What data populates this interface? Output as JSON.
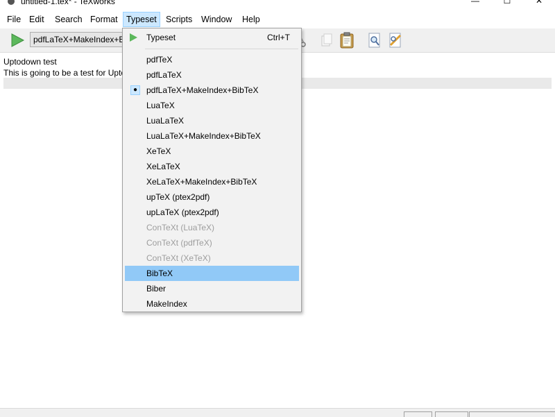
{
  "window": {
    "title": "untitled-1.tex* - TeXworks",
    "minimize_glyph": "—",
    "maximize_glyph": "☐",
    "close_glyph": "✕"
  },
  "menubar": {
    "file": "File",
    "edit": "Edit",
    "search": "Search",
    "format": "Format",
    "typeset": "Typeset",
    "scripts": "Scripts",
    "window": "Window",
    "help": "Help"
  },
  "toolbar": {
    "engine_selected": "pdfLaTeX+MakeIndex+BibTeX"
  },
  "editor": {
    "lines": [
      "Uptodown test",
      "This is going to be a test for Uptodown"
    ]
  },
  "typeset_menu": {
    "typeset_label": "Typeset",
    "typeset_shortcut": "Ctrl+T",
    "items": [
      {
        "label": "pdfTeX"
      },
      {
        "label": "pdfLaTeX"
      },
      {
        "label": "pdfLaTeX+MakeIndex+BibTeX"
      },
      {
        "label": "LuaTeX"
      },
      {
        "label": "LuaLaTeX"
      },
      {
        "label": "LuaLaTeX+MakeIndex+BibTeX"
      },
      {
        "label": "XeTeX"
      },
      {
        "label": "XeLaTeX"
      },
      {
        "label": "XeLaTeX+MakeIndex+BibTeX"
      },
      {
        "label": "upTeX (ptex2pdf)"
      },
      {
        "label": "upLaTeX (ptex2pdf)"
      },
      {
        "label": "ConTeXt (LuaTeX)"
      },
      {
        "label": "ConTeXt (pdfTeX)"
      },
      {
        "label": "ConTeXt (XeTeX)"
      },
      {
        "label": "BibTeX"
      },
      {
        "label": "Biber"
      },
      {
        "label": "MakeIndex"
      }
    ]
  },
  "colors": {
    "menu_highlight": "#91c9f7",
    "play_green": "#5cb85c",
    "disabled_text": "#9d9d9d"
  }
}
